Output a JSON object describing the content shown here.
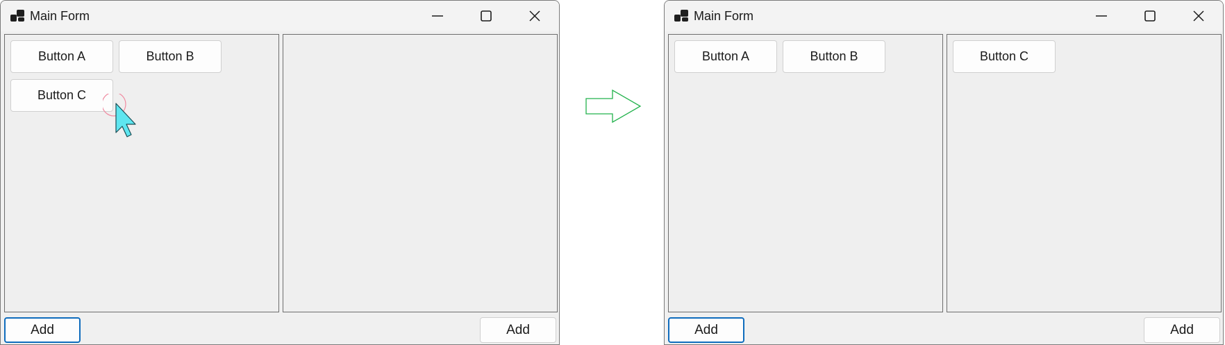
{
  "before": {
    "title": "Main Form",
    "left_panel_buttons": [
      "Button A",
      "Button B",
      "Button C"
    ],
    "right_panel_buttons": [],
    "add_left_label": "Add",
    "add_right_label": "Add"
  },
  "after": {
    "title": "Main Form",
    "left_panel_buttons": [
      "Button A",
      "Button B"
    ],
    "right_panel_buttons": [
      "Button C"
    ],
    "add_left_label": "Add",
    "add_right_label": "Add"
  },
  "colors": {
    "arrow": "#22b24c",
    "cursor": "#5ee6f0",
    "focus_border": "#0f6cbd",
    "click_ring": "#f08aa0"
  },
  "icons": [
    "app-icon",
    "minimize-icon",
    "maximize-icon",
    "close-icon",
    "mouse-cursor-icon",
    "right-arrow-icon"
  ]
}
